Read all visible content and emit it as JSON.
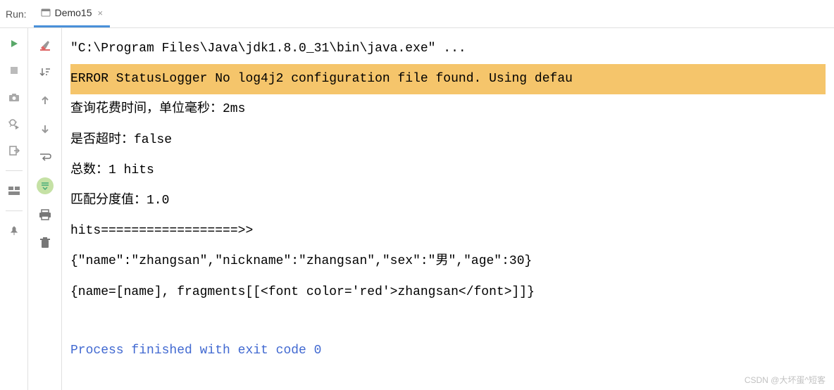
{
  "header": {
    "run_label": "Run:",
    "tab_name": "Demo15",
    "tab_close": "×"
  },
  "console": {
    "lines": [
      "\"C:\\Program Files\\Java\\jdk1.8.0_31\\bin\\java.exe\" ...",
      "ERROR StatusLogger No log4j2 configuration file found. Using defau",
      "查询花费时间，单位毫秒：2ms",
      "是否超时：false",
      "总数：1 hits",
      "匹配分度值：1.0",
      "hits==================>>",
      "{\"name\":\"zhangsan\",\"nickname\":\"zhangsan\",\"sex\":\"男\",\"age\":30}",
      "{name=[name], fragments[[<font color='red'>zhangsan</font>]]}"
    ],
    "process_line": "Process finished with exit code 0"
  },
  "watermark": "CSDN @大坏蛋^短客"
}
